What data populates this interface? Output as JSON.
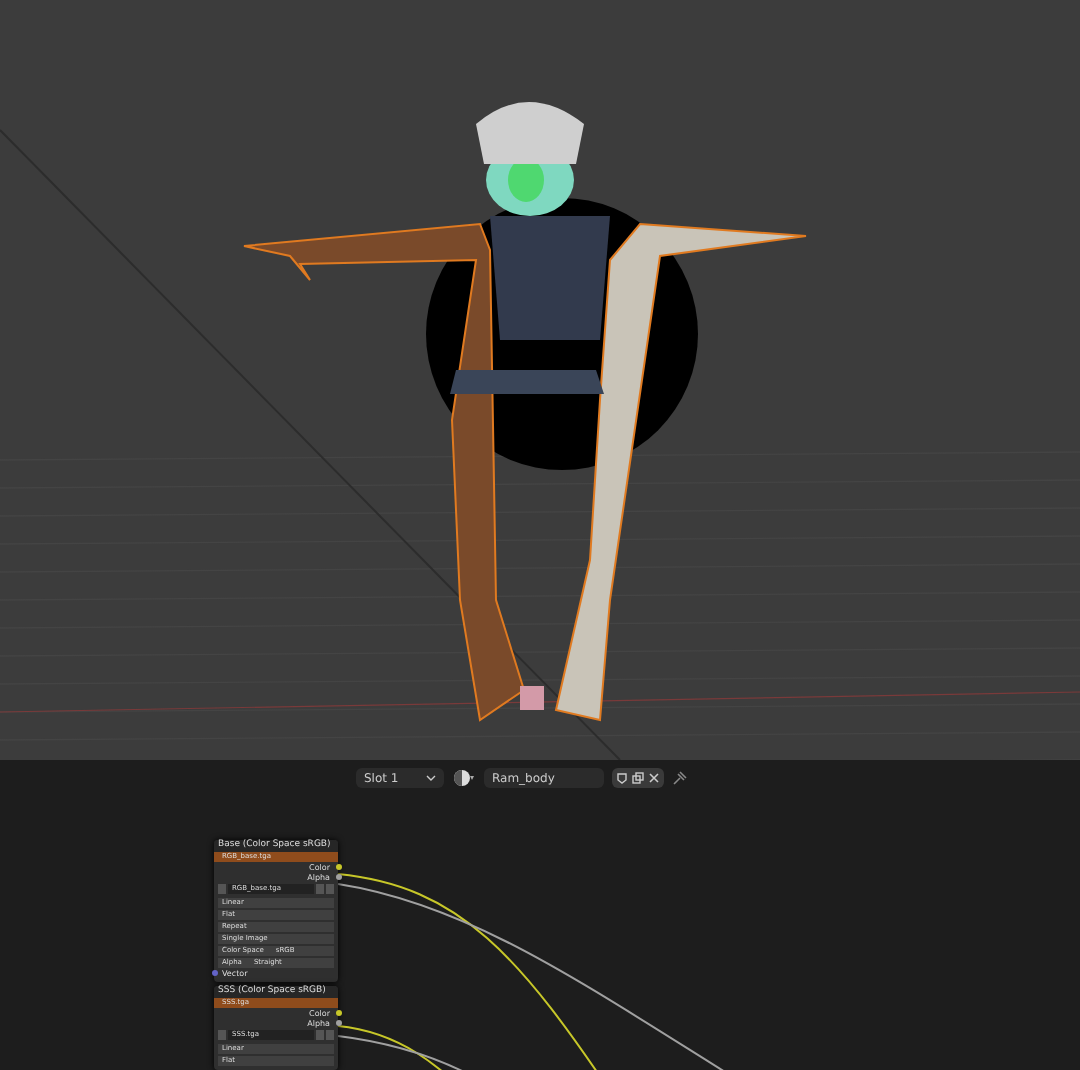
{
  "header": {
    "slot": "Slot 1",
    "material": "Ram_body"
  },
  "nodes": [
    {
      "title": "Base (Color Space sRGB)",
      "image_bar": "RGB_base.tga",
      "outputs": [
        {
          "label": "Color",
          "kind": "color"
        },
        {
          "label": "Alpha",
          "kind": "alpha"
        }
      ],
      "image": "RGB_base.tga",
      "rows": [
        {
          "label": "Linear"
        },
        {
          "label": "Flat"
        },
        {
          "label": "Repeat"
        },
        {
          "label": "Single Image"
        },
        {
          "label": "Color Space",
          "value": "sRGB"
        },
        {
          "label": "Alpha",
          "value": "Straight"
        }
      ],
      "input": "Vector"
    },
    {
      "title": "SSS (Color Space sRGB)",
      "image_bar": "SSS.tga",
      "outputs": [
        {
          "label": "Color",
          "kind": "color"
        },
        {
          "label": "Alpha",
          "kind": "alpha"
        }
      ],
      "image": "SSS.tga",
      "rows": [
        {
          "label": "Linear"
        },
        {
          "label": "Flat"
        }
      ]
    }
  ]
}
